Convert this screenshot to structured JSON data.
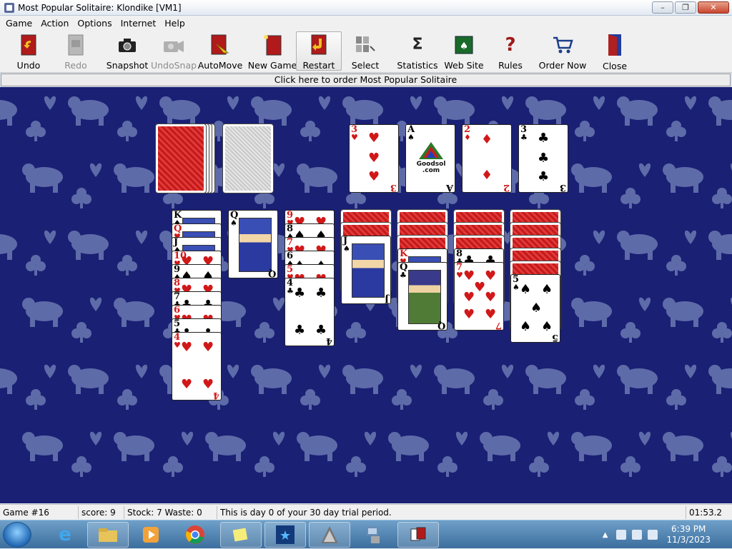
{
  "window": {
    "title": "Most Popular Solitaire: Klondike [VM1]",
    "minimize": "–",
    "maximize": "❐",
    "close": "✕"
  },
  "menu": [
    "Game",
    "Action",
    "Options",
    "Internet",
    "Help"
  ],
  "toolbar": {
    "undo": "Undo",
    "redo": "Redo",
    "snapshot": "Snapshot",
    "undosnap": "UndoSnap",
    "automove": "AutoMove",
    "newgame": "New Game",
    "restart": "Restart",
    "select": "Select",
    "statistics": "Statistics",
    "website": "Web Site",
    "rules": "Rules",
    "ordernow": "Order Now",
    "close": "Close"
  },
  "banner": "Click here to order Most Popular Solitaire",
  "game": {
    "foundations": [
      {
        "rank": "3",
        "suit": "♥",
        "color": "red"
      },
      {
        "rank": "A",
        "suit": "♠",
        "color": "black",
        "logo": "Goodsol .com"
      },
      {
        "rank": "2",
        "suit": "♦",
        "color": "red"
      },
      {
        "rank": "3",
        "suit": "♣",
        "color": "black"
      }
    ],
    "tableau": [
      {
        "hidden": 0,
        "cards": [
          {
            "rank": "K",
            "suit": "♠",
            "color": "black"
          },
          {
            "rank": "Q",
            "suit": "♥",
            "color": "red"
          },
          {
            "rank": "J",
            "suit": "♠",
            "color": "black"
          },
          {
            "rank": "10",
            "suit": "♥",
            "color": "red"
          },
          {
            "rank": "9",
            "suit": "♠",
            "color": "black"
          },
          {
            "rank": "8",
            "suit": "♥",
            "color": "red"
          },
          {
            "rank": "7",
            "suit": "♣",
            "color": "black"
          },
          {
            "rank": "6",
            "suit": "♥",
            "color": "red"
          },
          {
            "rank": "5",
            "suit": "♣",
            "color": "black"
          },
          {
            "rank": "4",
            "suit": "♥",
            "color": "red"
          }
        ]
      },
      {
        "hidden": 0,
        "cards": [
          {
            "rank": "Q",
            "suit": "♠",
            "color": "black"
          }
        ]
      },
      {
        "hidden": 0,
        "cards": [
          {
            "rank": "9",
            "suit": "♥",
            "color": "red"
          },
          {
            "rank": "8",
            "suit": "♠",
            "color": "black"
          },
          {
            "rank": "7",
            "suit": "♥",
            "color": "red"
          },
          {
            "rank": "6",
            "suit": "♠",
            "color": "black"
          },
          {
            "rank": "5",
            "suit": "♥",
            "color": "red"
          },
          {
            "rank": "4",
            "suit": "♣",
            "color": "black"
          }
        ]
      },
      {
        "hidden": 2,
        "cards": [
          {
            "rank": "J",
            "suit": "♠",
            "color": "black"
          }
        ]
      },
      {
        "hidden": 3,
        "cards": [
          {
            "rank": "K",
            "suit": "♥",
            "color": "red"
          },
          {
            "rank": "Q",
            "suit": "♣",
            "color": "black"
          }
        ]
      },
      {
        "hidden": 3,
        "cards": [
          {
            "rank": "8",
            "suit": "♣",
            "color": "black"
          },
          {
            "rank": "7",
            "suit": "♥",
            "color": "red"
          }
        ]
      },
      {
        "hidden": 5,
        "cards": [
          {
            "rank": "5",
            "suit": "♠",
            "color": "black"
          }
        ]
      }
    ]
  },
  "status": {
    "game": "Game #16",
    "score": "score: 9",
    "stock_waste": "Stock: 7  Waste: 0",
    "trial": "This is day 0 of your 30 day trial period.",
    "time": "01:53.2"
  },
  "taskbar": {
    "time": "6:39 PM",
    "date": "11/3/2023"
  }
}
